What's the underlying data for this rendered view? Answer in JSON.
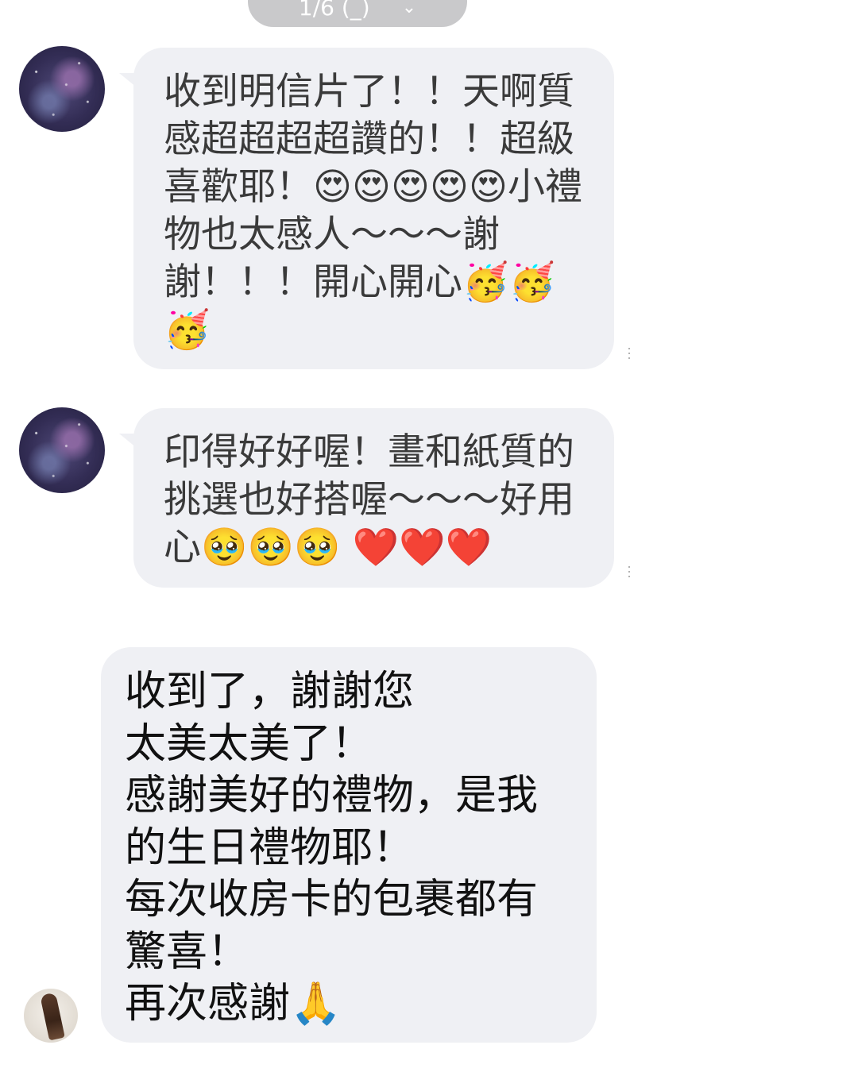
{
  "header": {
    "page_indicator": "1/6  (_)",
    "chevron_icon": "chevron-down-icon"
  },
  "messages": [
    {
      "sender": "other",
      "avatar": "galaxy-avatar",
      "text": "收到明信片了！！天啊質感超超超超讚的！！超級喜歡耶！😍😍😍😍😍小禮物也太感人～～～謝謝！！！開心開心🥳🥳🥳"
    },
    {
      "sender": "other",
      "avatar": "galaxy-avatar",
      "text": "印得好好喔！畫和紙質的挑選也好搭喔～～～好用心🥹🥹🥹 ❤️❤️❤️"
    },
    {
      "sender": "other",
      "avatar": "photo-avatar",
      "text": "收到了，謝謝您\n太美太美了！\n感謝美好的禮物，是我的生日禮物耶！\n每次收房卡的包裹都有驚喜！\n再次感謝🙏"
    }
  ],
  "colors": {
    "bubble_bg": "#eff0f4",
    "pill_bg": "#c9c9cb",
    "text_dark": "#111111",
    "text_mid": "#3a3a3a"
  }
}
